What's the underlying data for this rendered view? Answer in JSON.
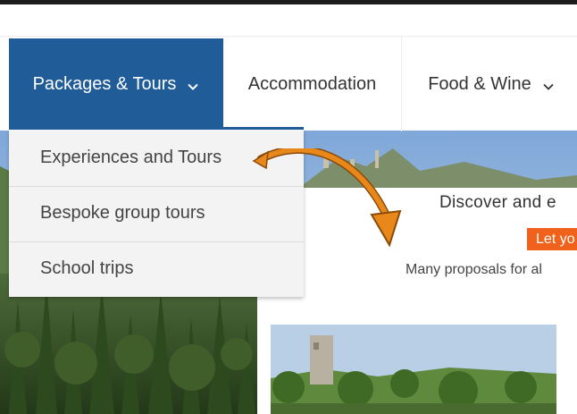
{
  "nav": {
    "items": [
      {
        "label": "Packages & Tours",
        "active": true,
        "has_dropdown": true
      },
      {
        "label": "Accommodation",
        "active": false,
        "has_dropdown": false
      },
      {
        "label": "Food & Wine",
        "active": false,
        "has_dropdown": true
      }
    ]
  },
  "dropdown": {
    "items": [
      {
        "label": "Experiences and Tours"
      },
      {
        "label": "Bespoke group tours"
      },
      {
        "label": "School trips"
      }
    ]
  },
  "card": {
    "heading": "Discover and e",
    "tag": "Let yo",
    "subheading": "Many proposals for al"
  },
  "colors": {
    "nav_active_bg": "#1f5c98",
    "dropdown_bg": "#f3f3f3",
    "tag_bg": "#f0621c",
    "arrow": "#e8871a"
  },
  "icons": {
    "dropdown_chevron": "chevron-down-icon",
    "annotation": "curved-arrow-icon"
  }
}
